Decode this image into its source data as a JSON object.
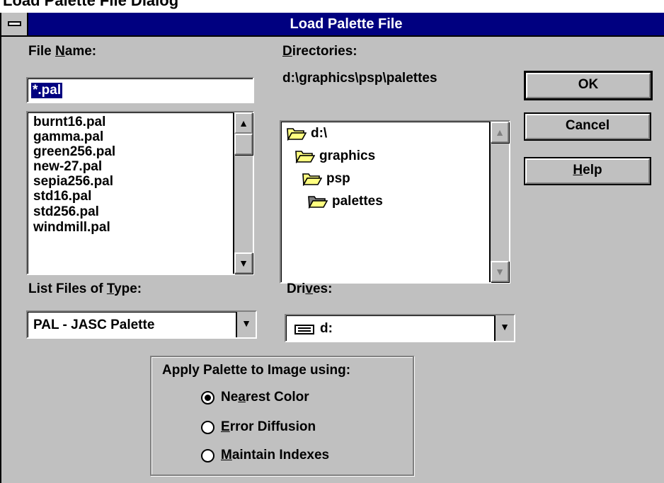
{
  "outer_caption": "Load Palette File Dialog",
  "window": {
    "title": "Load Palette File"
  },
  "file_name": {
    "label_pre": "File ",
    "label_key": "N",
    "label_post": "ame:",
    "value": "*.pal",
    "files": [
      "burnt16.pal",
      "gamma.pal",
      "green256.pal",
      "new-27.pal",
      "sepia256.pal",
      "std16.pal",
      "std256.pal",
      "windmill.pal"
    ]
  },
  "directories": {
    "label_key": "D",
    "label_post": "irectories:",
    "current_path": "d:\\graphics\\psp\\palettes",
    "items": [
      {
        "name": "d:\\",
        "icon": "open-folder-icon"
      },
      {
        "name": "graphics",
        "icon": "open-folder-icon"
      },
      {
        "name": "psp",
        "icon": "open-folder-icon"
      },
      {
        "name": "palettes",
        "icon": "open-folder-selected-icon"
      }
    ]
  },
  "file_type": {
    "label_pre": "List Files of ",
    "label_key": "T",
    "label_post": "ype:",
    "selected": "PAL - JASC Palette"
  },
  "drives": {
    "label_pre": "Dri",
    "label_key": "v",
    "label_post": "es:",
    "selected": "d:"
  },
  "buttons": {
    "ok": "OK",
    "cancel": "Cancel",
    "help_key": "H",
    "help_post": "elp"
  },
  "apply_palette": {
    "title": "Apply Palette to Image using:",
    "options": [
      {
        "pre": "Ne",
        "key": "a",
        "post": "rest Color",
        "checked": true
      },
      {
        "pre": "",
        "key": "E",
        "post": "rror Diffusion",
        "checked": false
      },
      {
        "pre": "",
        "key": "M",
        "post": "aintain Indexes",
        "checked": false
      }
    ]
  },
  "icons": {
    "system_menu": "system-menu-icon",
    "scroll_up": "scroll-up-arrow-icon",
    "scroll_down": "scroll-down-arrow-icon",
    "dropdown": "dropdown-arrow-icon",
    "drive": "drive-icon"
  },
  "colors": {
    "titlebar": "#000080",
    "face": "#c0c0c0",
    "selection": "#000080",
    "folder": "#ffff80"
  }
}
